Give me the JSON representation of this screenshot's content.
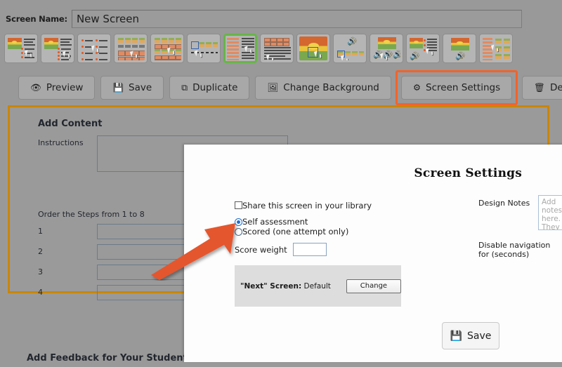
{
  "window": {
    "background_color": "#999999",
    "accent_orange": "#f2632a",
    "panel_border_gold": "#c8860b",
    "selected_template_green": "#69b44b"
  },
  "screen_name_row": {
    "label": "Screen Name:",
    "value": "New Screen",
    "placeholder": "Screen Name"
  },
  "template_strip": {
    "items": [
      {
        "name": "image-and-text-click",
        "selected": false
      },
      {
        "name": "image-and-text-list-click",
        "selected": false
      },
      {
        "name": "two-column-text-match",
        "selected": false
      },
      {
        "name": "grid-tiles-click",
        "selected": false
      },
      {
        "name": "image-grid-match",
        "selected": false
      },
      {
        "name": "drag-tiles-sequence",
        "selected": false
      },
      {
        "name": "two-column-ordering",
        "selected": true
      },
      {
        "name": "text-lines-list",
        "selected": false
      },
      {
        "name": "hotspot-on-image",
        "selected": false
      },
      {
        "name": "audio-with-tiles",
        "selected": false
      },
      {
        "name": "image-with-multiple-audio",
        "selected": false
      },
      {
        "name": "image-audio-text-list",
        "selected": false
      },
      {
        "name": "image-with-audio",
        "selected": false
      },
      {
        "name": "list-to-grid-match",
        "selected": false
      }
    ]
  },
  "action_bar": {
    "buttons": [
      {
        "label": "Preview",
        "icon": "eye-icon",
        "highlighted": false
      },
      {
        "label": "Save",
        "icon": "floppy-disk-icon",
        "highlighted": false
      },
      {
        "label": "Duplicate",
        "icon": "copy-icon",
        "highlighted": false
      },
      {
        "label": "Change Background",
        "icon": "image-icon",
        "highlighted": false
      },
      {
        "label": "Screen Settings",
        "icon": "gear-icon",
        "highlighted": true
      },
      {
        "label": "Delete",
        "icon": "trash-icon",
        "highlighted": false
      }
    ]
  },
  "content_panel": {
    "title": "Add Content",
    "instructions_label": "Instructions",
    "instructions_value": "",
    "order_label": "Order the Steps from 1 to 8",
    "steps": [
      {
        "number": "1",
        "value": ""
      },
      {
        "number": "2",
        "value": ""
      },
      {
        "number": "3",
        "value": ""
      },
      {
        "number": "4",
        "value": ""
      }
    ],
    "feedback_heading": "Add Feedback for Your Students"
  },
  "modal": {
    "title": "Screen Settings",
    "share_checkbox": {
      "label": "Share this screen in your library",
      "checked": false
    },
    "assessment_mode": {
      "options": [
        {
          "label": "Self assessment",
          "selected": true
        },
        {
          "label": "Scored (one attempt only)",
          "selected": false
        }
      ]
    },
    "score_weight": {
      "label": "Score weight",
      "value": ""
    },
    "next_screen": {
      "prefix": "\"Next\" Screen:",
      "value": "Default",
      "change_label": "Change"
    },
    "design_notes": {
      "label": "Design Notes",
      "value": "",
      "placeholder": "Add notes here. They are searchable."
    },
    "disable_navigation": {
      "label": "Disable navigation for (seconds)",
      "value": ""
    },
    "save_button": {
      "label": "Save",
      "icon": "floppy-disk-icon"
    }
  },
  "annotation": {
    "type": "arrow",
    "color": "#e4572e",
    "points_to": "self-assessment-radio"
  }
}
